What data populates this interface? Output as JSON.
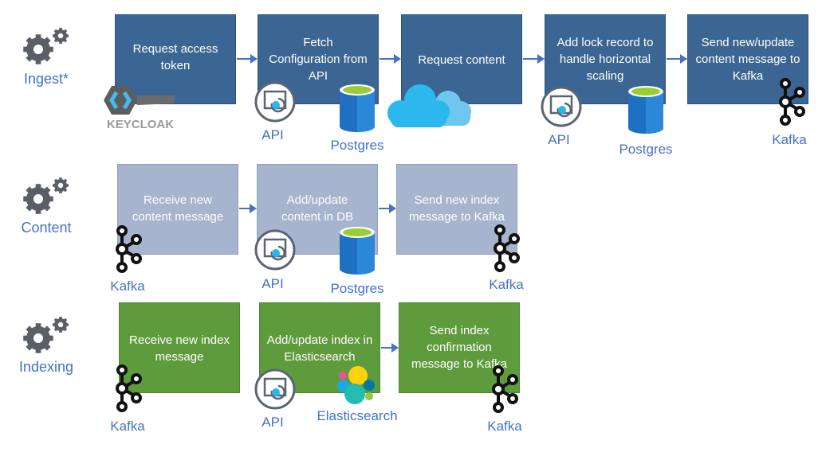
{
  "rows": [
    {
      "label": "Ingest*",
      "color": "#3b6593",
      "steps": [
        "Request access token",
        "Fetch Configuration from API",
        "Request content",
        "Add lock record to handle horizontal scaling",
        "Send new/update content message to Kafka"
      ]
    },
    {
      "label": "Content",
      "color": "#a6b5cd",
      "steps": [
        "Receive new content message",
        "Add/update content in DB",
        "Send new index message to Kafka"
      ]
    },
    {
      "label": "Indexing",
      "color": "#5e9b3d",
      "steps": [
        "Receive new index message",
        "Add/update index in Elasticsearch",
        "Send index confirmation message to Kafka"
      ]
    }
  ],
  "icon_labels": {
    "keycloak": "KEYCLOAK",
    "api": "API",
    "postgres": "Postgres",
    "kafka": "Kafka",
    "elasticsearch": "Elasticsearch"
  },
  "accent_color": "#4472c4"
}
